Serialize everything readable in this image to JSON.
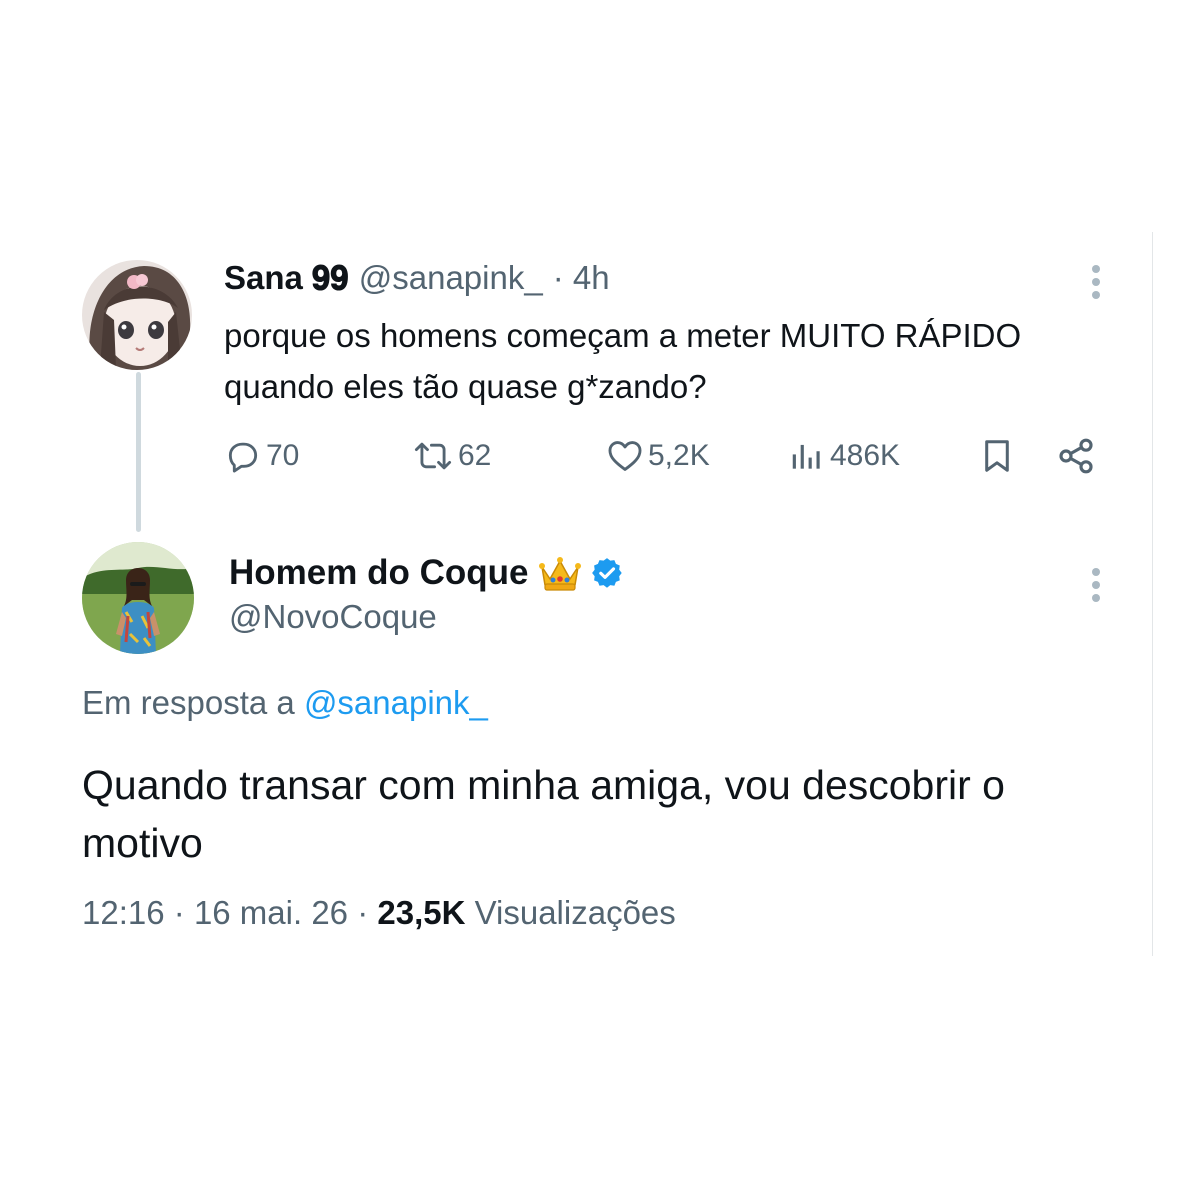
{
  "parent_tweet": {
    "display_name": "Sana 𝟗𝟗",
    "handle": "@sanapink_",
    "time": "· 4h",
    "text": "porque os homens começam a meter MUITO RÁPIDO quando eles tão quase g*zando?",
    "stats": {
      "replies": "70",
      "retweets": "62",
      "likes": "5,2K",
      "views": "486K"
    }
  },
  "reply_tweet": {
    "display_name": "Homem do Coque",
    "handle": "@NovoCoque",
    "verified": true,
    "reply_prefix": "Em resposta a",
    "reply_mention": "@sanapink_",
    "text": "Quando transar com minha amiga, vou descobrir o motivo",
    "time": "12:16",
    "date": "16 mai. 26",
    "views_count": "23,5K",
    "views_label": "Visualizações"
  },
  "icons": {
    "reply": "reply-icon",
    "retweet": "retweet-icon",
    "like": "heart-icon",
    "views": "views-icon",
    "bookmark": "bookmark-icon",
    "share": "share-icon",
    "more": "more-icon",
    "crown": "crown-emoji",
    "verified": "verified-badge-icon"
  },
  "colors": {
    "text": "#0f1419",
    "secondary": "#536471",
    "accent": "#1d9bf0",
    "thread_line": "#cfd9de"
  }
}
